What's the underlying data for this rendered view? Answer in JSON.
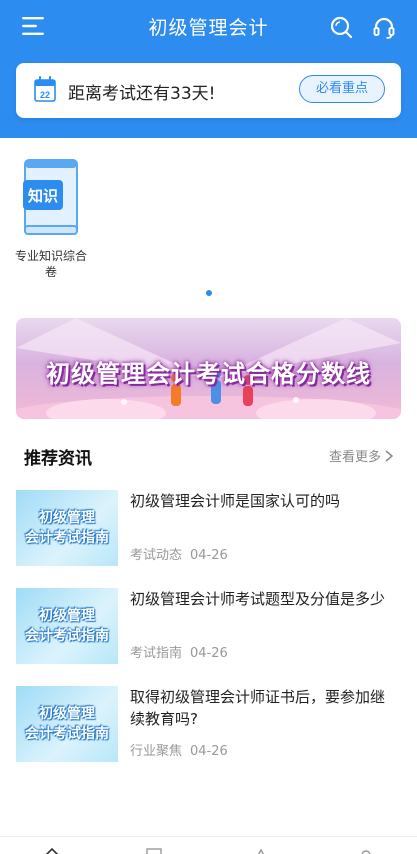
{
  "header": {
    "title": "初级管理会计",
    "icons": [
      "menu-icon",
      "search-icon",
      "headset-icon"
    ],
    "background_color": "#2d8cf0"
  },
  "countdown": {
    "calendar_day": "22",
    "text": "距离考试还有33天!",
    "button_label": "必看重点"
  },
  "categories": [
    {
      "icon_text": "知识",
      "label": "专业知识综合卷"
    }
  ],
  "carousel": {
    "pages": 1,
    "active_page": 1
  },
  "banner": {
    "text": "初级管理会计考试合格分数线"
  },
  "news_section": {
    "title": "推荐资讯",
    "more_label": "查看更多",
    "items": [
      {
        "thumb_line1": "初级管理",
        "thumb_line2": "会计考试指南",
        "title": "初级管理会计师是国家认可的吗",
        "tag": "考试动态",
        "date": "04-26"
      },
      {
        "thumb_line1": "初级管理",
        "thumb_line2": "会计考试指南",
        "title": "初级管理会计师考试题型及分值是多少",
        "tag": "考试指南",
        "date": "04-26"
      },
      {
        "thumb_line1": "初级管理",
        "thumb_line2": "会计考试指南",
        "title": "取得初级管理会计师证书后，要参加继续教育吗?",
        "tag": "行业聚焦",
        "date": "04-26"
      }
    ]
  },
  "tabbar": {
    "icons": [
      "home-icon",
      "book-icon",
      "bell-icon",
      "user-icon"
    ]
  }
}
